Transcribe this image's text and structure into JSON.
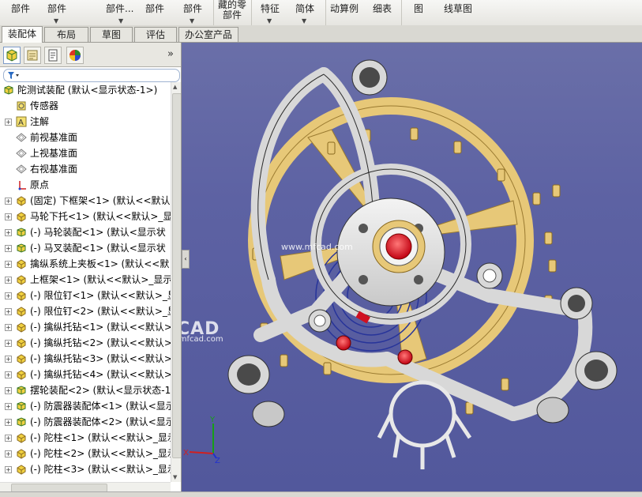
{
  "ribbon": {
    "buttons": [
      "部件",
      "部件",
      "",
      "部件...",
      "部件",
      "部件",
      "藏的零部件",
      "特征",
      "简体",
      "动算例",
      "细表",
      "图",
      "线草图"
    ],
    "colors": {
      "accent": "#2a6bc2"
    }
  },
  "tabs": [
    "装配体",
    "布局",
    "草图",
    "评估",
    "办公室产品"
  ],
  "panel": {
    "expand_label": "»",
    "filter_icon": "funnel-icon",
    "tree": [
      {
        "label": "陀测试装配 (默认<显示状态-1>)",
        "icon": "assembly-icon",
        "expander": false,
        "indent": 0
      },
      {
        "label": "传感器",
        "icon": "sensor-icon",
        "expander": false,
        "indent": 1
      },
      {
        "label": "注解",
        "icon": "annotation-icon",
        "expander": true,
        "indent": 1
      },
      {
        "label": "前视基准面",
        "icon": "plane-icon",
        "expander": false,
        "indent": 1
      },
      {
        "label": "上视基准面",
        "icon": "plane-icon",
        "expander": false,
        "indent": 1
      },
      {
        "label": "右视基准面",
        "icon": "plane-icon",
        "expander": false,
        "indent": 1
      },
      {
        "label": "原点",
        "icon": "origin-icon",
        "expander": false,
        "indent": 1
      },
      {
        "label": "(固定) 下框架<1> (默认<<默认",
        "icon": "part-icon",
        "expander": true,
        "indent": 1
      },
      {
        "label": "马轮下托<1> (默认<<默认>_显",
        "icon": "part-icon",
        "expander": true,
        "indent": 1
      },
      {
        "label": "(-) 马轮装配<1> (默认<显示状",
        "icon": "assembly-icon",
        "expander": true,
        "indent": 1
      },
      {
        "label": "(-) 马叉装配<1> (默认<显示状",
        "icon": "assembly-icon",
        "expander": true,
        "indent": 1
      },
      {
        "label": "擒纵系统上夹板<1> (默认<<默",
        "icon": "part-icon",
        "expander": true,
        "indent": 1
      },
      {
        "label": "上框架<1> (默认<<默认>_显示",
        "icon": "part-icon",
        "expander": true,
        "indent": 1
      },
      {
        "label": "(-) 限位钉<1> (默认<<默认>_显",
        "icon": "part-icon",
        "expander": true,
        "indent": 1
      },
      {
        "label": "(-) 限位钉<2> (默认<<默认>_显",
        "icon": "part-icon",
        "expander": true,
        "indent": 1
      },
      {
        "label": "(-) 擒纵托钻<1> (默认<<默认>",
        "icon": "part-icon",
        "expander": true,
        "indent": 1
      },
      {
        "label": "(-) 擒纵托钻<2> (默认<<默认>",
        "icon": "part-icon",
        "expander": true,
        "indent": 1
      },
      {
        "label": "(-) 擒纵托钻<3> (默认<<默认>",
        "icon": "part-icon",
        "expander": true,
        "indent": 1
      },
      {
        "label": "(-) 擒纵托钻<4> (默认<<默认>",
        "icon": "part-icon",
        "expander": true,
        "indent": 1
      },
      {
        "label": "摆轮装配<2> (默认<显示状态-1",
        "icon": "assembly-icon",
        "expander": true,
        "indent": 1
      },
      {
        "label": "(-) 防震器装配体<1> (默认<显示",
        "icon": "assembly-icon",
        "expander": true,
        "indent": 1
      },
      {
        "label": "(-) 防震器装配体<2> (默认<显示",
        "icon": "assembly-icon",
        "expander": true,
        "indent": 1
      },
      {
        "label": "(-) 陀柱<1> (默认<<默认>_显示",
        "icon": "part-icon",
        "expander": true,
        "indent": 1
      },
      {
        "label": "(-) 陀柱<2> (默认<<默认>_显示",
        "icon": "part-icon",
        "expander": true,
        "indent": 1
      },
      {
        "label": "(-) 陀柱<3> (默认<<默认>_显示",
        "icon": "part-icon",
        "expander": true,
        "indent": 1
      }
    ]
  },
  "viewport": {
    "watermark_url": "www.mfcad.com",
    "watermark_logo": "沐风CAD",
    "watermark_logo_sub": "www.mfcad.com",
    "colors": {
      "background": "#5d62a3",
      "frame": "#d8d8d8",
      "gold": "#e7c878",
      "spring": "#27349a",
      "jewel": "#e0141a"
    }
  }
}
